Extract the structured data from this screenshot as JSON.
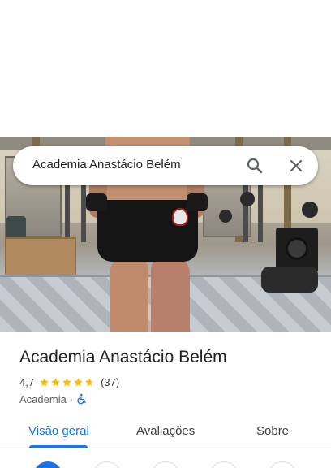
{
  "search": {
    "query": "Academia Anastácio Belém",
    "search_icon": "search-icon",
    "close_icon": "close-icon"
  },
  "place": {
    "name": "Academia Anastácio Belém",
    "rating": "4,7",
    "rating_value": 4.7,
    "review_count": "(37)",
    "category": "Academia",
    "separator": "·",
    "accessibility_icon": "wheelchair-icon"
  },
  "tabs": [
    {
      "label": "Visão geral",
      "active": true
    },
    {
      "label": "Avaliações",
      "active": false
    },
    {
      "label": "Sobre",
      "active": false
    }
  ],
  "colors": {
    "accent": "#1a73e8",
    "star": "#fbbc04",
    "text": "#202124",
    "secondary_text": "#5f6368"
  }
}
